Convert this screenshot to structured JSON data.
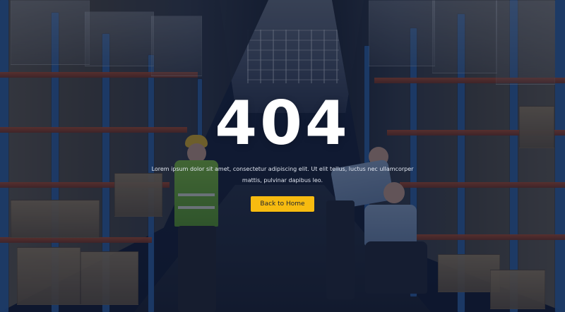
{
  "hero": {
    "error_code": "404",
    "message": "Lorem ipsum dolor sit amet, consectetur adipiscing elit. Ut elit tellus, luctus nec ullamcorper mattis, pulvinar dapibus leo."
  },
  "actions": {
    "back_home_label": "Back to Home"
  },
  "colors": {
    "accent_button": "#f7bb10",
    "overlay_blue": "#0c152b"
  },
  "media": {
    "background_scene": "warehouse-aisle-photo"
  }
}
